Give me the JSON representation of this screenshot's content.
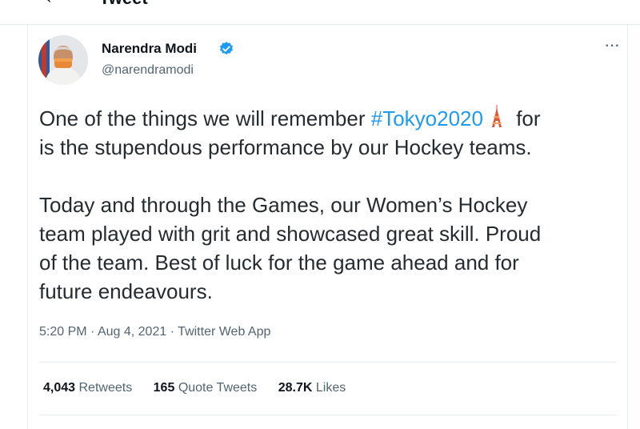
{
  "header": {
    "title": "Tweet"
  },
  "author": {
    "name": "Narendra Modi",
    "handle": "@narendramodi"
  },
  "tweet": {
    "line1_before": "One of the things we will remember ",
    "hashtag": "#Tokyo2020",
    "line1_after": " for",
    "line2": "is the stupendous performance by our Hockey teams.",
    "paragraph2": "Today and through the Games, our Women’s Hockey\nteam played with grit and showcased great skill. Proud\nof the team. Best of luck for the game ahead and for\nfuture endeavours."
  },
  "meta": {
    "time": "5:20 PM",
    "date": "Aug 4, 2021",
    "source": "Twitter Web App"
  },
  "stats": {
    "retweets_count": "4,043",
    "retweets_label": "Retweets",
    "quotes_count": "165",
    "quotes_label": "Quote Tweets",
    "likes_count": "28.7K",
    "likes_label": "Likes"
  },
  "colors": {
    "accent": "#1d9bf0",
    "text": "#0f1419",
    "secondary": "#536471"
  }
}
